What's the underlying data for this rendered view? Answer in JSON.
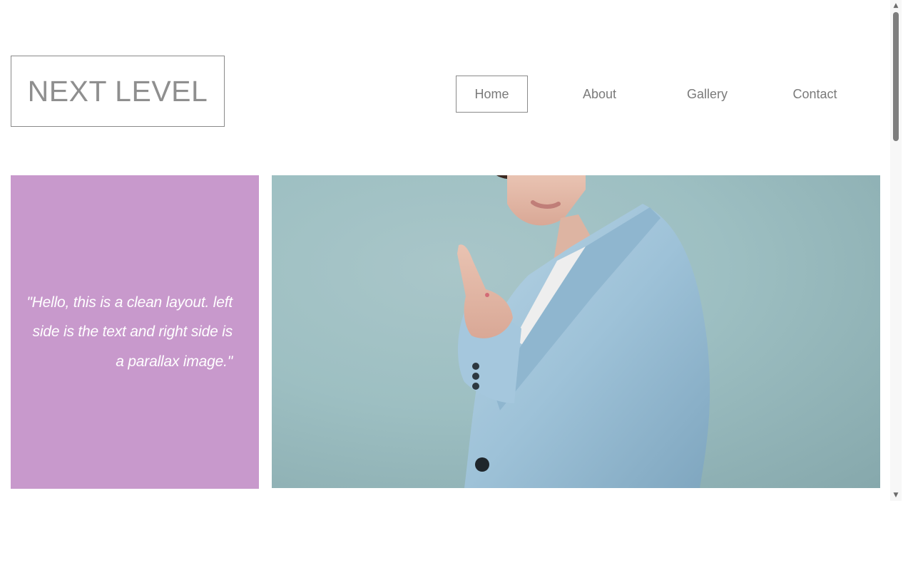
{
  "header": {
    "logo_text": "NEXT LEVEL"
  },
  "nav": {
    "items": [
      {
        "label": "Home",
        "active": true
      },
      {
        "label": "About",
        "active": false
      },
      {
        "label": "Gallery",
        "active": false
      },
      {
        "label": "Contact",
        "active": false
      }
    ]
  },
  "hero": {
    "quote": "\"Hello, this is a clean layout. left side is the text and right side is a parallax image.\"",
    "panel_color": "#c899cc",
    "image_icon": "woman-in-blue-blazer-pointing-photo"
  },
  "scrollbar": {
    "up_icon": "scroll-up-arrow-icon",
    "down_icon": "scroll-down-arrow-icon"
  }
}
